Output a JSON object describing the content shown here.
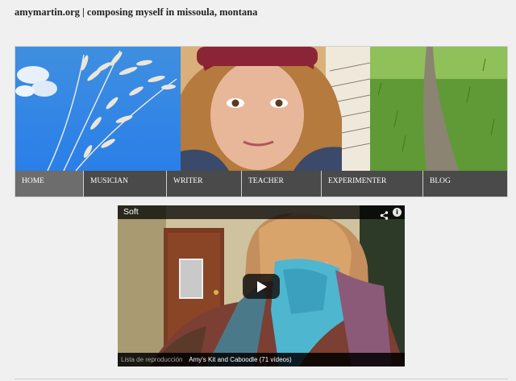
{
  "site": {
    "title": "amymartin.org | composing myself in missoula, montana"
  },
  "banner": {
    "photos": [
      {
        "icon": "sky-grass-photo"
      },
      {
        "icon": "portrait-photo"
      },
      {
        "icon": "field-path-photo"
      }
    ]
  },
  "nav": {
    "items": [
      {
        "label": "HOME",
        "active": true
      },
      {
        "label": "MUSICIAN"
      },
      {
        "label": "WRITER"
      },
      {
        "label": "TEACHER"
      },
      {
        "label": "EXPERIMENTER"
      },
      {
        "label": "BLOG"
      }
    ]
  },
  "video": {
    "title": "Soft",
    "info_glyph": "i",
    "playlist_label": "Lista de reproducción",
    "playlist_name": "Amy's Kit and Caboodle (71 vídeos)",
    "icons": {
      "share": "share-icon",
      "info": "info-icon",
      "play": "play-icon"
    }
  },
  "colors": {
    "nav_bg": "#4a4a4a",
    "nav_active": "#6d6d6d",
    "page_bg": "#f0f0f0"
  }
}
